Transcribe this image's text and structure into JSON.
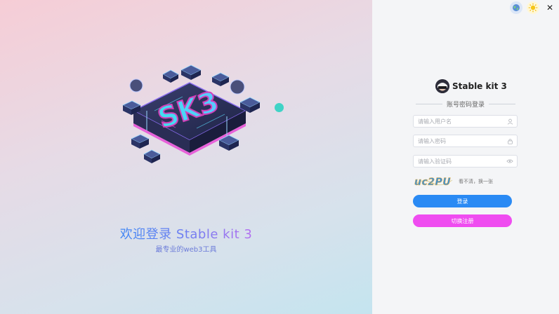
{
  "welcome": {
    "title": "欢迎登录 Stable kit 3",
    "subtitle": "最专业的web3工具"
  },
  "hero": {
    "logo_text": "SK3"
  },
  "window": {
    "close_label": "✕"
  },
  "brand": {
    "name": "Stable kit 3"
  },
  "login_form": {
    "mode_label": "账号密码登录",
    "username": {
      "value": "",
      "placeholder": "请输入用户名"
    },
    "password": {
      "value": "",
      "placeholder": "请输入密码"
    },
    "captcha_input": {
      "value": "",
      "placeholder": "请输入验证码"
    },
    "captcha_code": "uc2PU",
    "captcha_hint": "看不清，换一张",
    "login_button": "登录",
    "register_button": "切换注册"
  },
  "colors": {
    "primary_blue": "#2a8af4",
    "register_pink": "#ef4cf0",
    "accent_teal": "#3fd3c6"
  },
  "icons": [
    "globe-icon",
    "sun-icon",
    "close-icon",
    "user-icon",
    "lock-icon",
    "eye-off-icon"
  ]
}
